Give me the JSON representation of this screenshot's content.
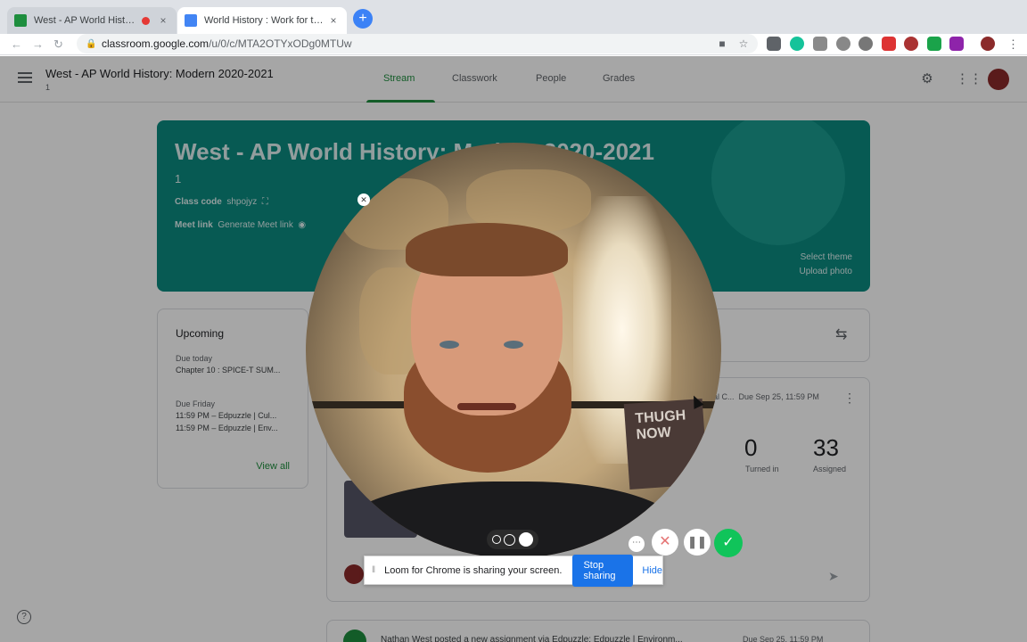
{
  "browser": {
    "tabs": [
      {
        "title": "West - AP World History: M",
        "favicon_color": "#1e8e3e",
        "recording": true
      },
      {
        "title": "World History : Work for the W",
        "favicon_color": "#4285f4",
        "recording": false
      }
    ],
    "close_glyph": "×",
    "newtab_glyph": "+",
    "url_host": "classroom.google.com",
    "url_path": "/u/0/c/MTA2OTYxODg0MTUw"
  },
  "classroom": {
    "class_title": "West - AP World History: Modern 2020-2021",
    "class_section": "1",
    "tabs": [
      "Stream",
      "Classwork",
      "People",
      "Grades"
    ],
    "banner": {
      "title": "West - AP World History: Modern 2020-2021",
      "section": "1",
      "class_code_label": "Class code",
      "class_code": "shpojyz",
      "meet_label": "Meet link",
      "meet_action": "Generate Meet link",
      "select_theme": "Select theme",
      "upload_photo": "Upload photo",
      "color": "#0b8a80"
    },
    "upcoming": {
      "heading": "Upcoming",
      "groups": [
        {
          "due": "Due today",
          "items": [
            "Chapter 10 : SPICE-T SUM..."
          ]
        },
        {
          "due": "Due Friday",
          "items": [
            "11:59 PM – Edpuzzle | Cul...",
            "11:59 PM – Edpuzzle | Env..."
          ]
        }
      ],
      "view_all": "View all"
    },
    "post": {
      "title_fragment": "al C...",
      "due": "Due Sep 25, 11:59 PM",
      "turned_in_count": "0",
      "turned_in_label": "Turned in",
      "assigned_count": "33",
      "assigned_label": "Assigned"
    },
    "bottom_post": {
      "text": "Nathan West posted a new assignment via Edpuzzle: Edpuzzle | Environm...",
      "due": "Due Sep 25, 11:59 PM"
    }
  },
  "loom": {
    "share_message": "Loom for Chrome is sharing your screen.",
    "stop_sharing": "Stop sharing",
    "hide": "Hide",
    "book_text": "THUGH NOW"
  },
  "colors": {
    "accent": "#1e8e3e",
    "stop_button": "#1a73e8",
    "done_button": "#10c45a"
  }
}
